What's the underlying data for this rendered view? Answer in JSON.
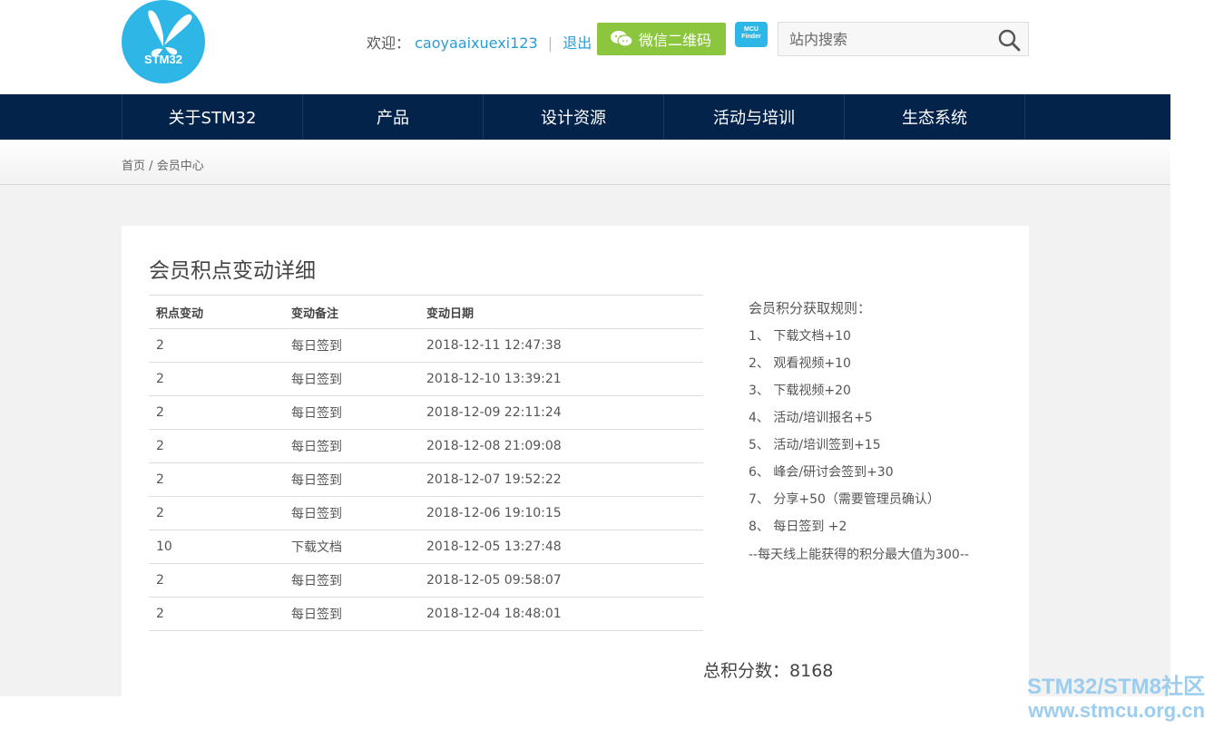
{
  "header": {
    "logo_text": "STM32",
    "welcome_label": "欢迎：",
    "username": "caoyaaixuexi123",
    "separator": "|",
    "logout_label": "退出",
    "wechat_label": "微信二维码",
    "mcu_finder_line1": "MCU",
    "mcu_finder_line2": "Finder",
    "search_placeholder": "站内搜索"
  },
  "nav": {
    "items": [
      "关于STM32",
      "产品",
      "设计资源",
      "活动与培训",
      "生态系统"
    ]
  },
  "breadcrumb": {
    "home": "首页",
    "divider": "/",
    "current": "会员中心"
  },
  "main": {
    "title": "会员积点变动详细",
    "table": {
      "headers": [
        "积点变动",
        "变动备注",
        "变动日期"
      ],
      "rows": [
        [
          "2",
          "每日签到",
          "2018-12-11 12:47:38"
        ],
        [
          "2",
          "每日签到",
          "2018-12-10 13:39:21"
        ],
        [
          "2",
          "每日签到",
          "2018-12-09 22:11:24"
        ],
        [
          "2",
          "每日签到",
          "2018-12-08 21:09:08"
        ],
        [
          "2",
          "每日签到",
          "2018-12-07 19:52:22"
        ],
        [
          "2",
          "每日签到",
          "2018-12-06 19:10:15"
        ],
        [
          "10",
          "下载文档",
          "2018-12-05 13:27:48"
        ],
        [
          "2",
          "每日签到",
          "2018-12-05 09:58:07"
        ],
        [
          "2",
          "每日签到",
          "2018-12-04 18:48:01"
        ]
      ]
    },
    "rules": {
      "title": "会员积分获取规则：",
      "items": [
        "1、 下载文档+10",
        "2、 观看视频+10",
        "3、 下载视频+20",
        "4、 活动/培训报名+5",
        "5、 活动/培训签到+15",
        "6、 峰会/研讨会签到+30",
        "7、 分享+50（需要管理员确认）",
        "8、 每日签到 +2"
      ],
      "note": "--每天线上能获得的积分最大值为300--"
    },
    "total_label": "总积分数：",
    "total_value": "8168"
  },
  "watermark": {
    "line1": "STM32/STM8社区",
    "line2": "www.stmcu.org.cn"
  },
  "colors": {
    "brand_blue": "#2db6e6",
    "nav_bg": "#03234b",
    "wechat_green": "#8cc63f",
    "link_blue": "#2a9bd6"
  },
  "icons": {
    "logo": "butterfly-logo-icon",
    "wechat": "wechat-icon",
    "search": "search-icon"
  }
}
